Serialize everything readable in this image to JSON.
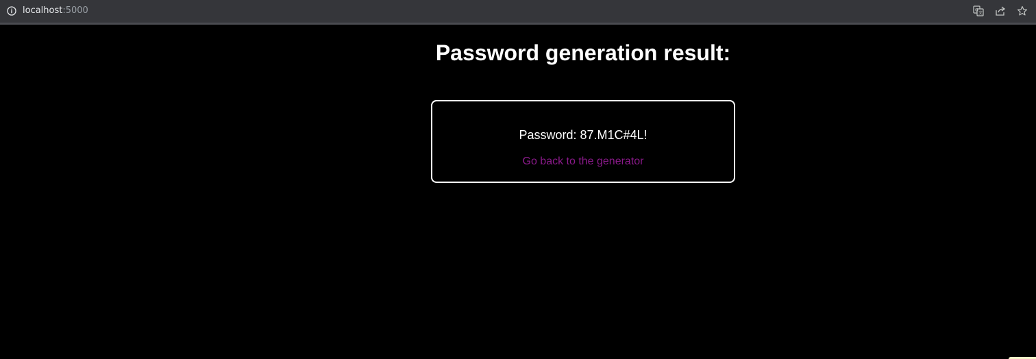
{
  "browser": {
    "url_host": "localhost",
    "url_port": ":5000",
    "icons": [
      "info-icon",
      "translate-icon",
      "share-icon",
      "star-icon"
    ]
  },
  "page": {
    "title": "Password generation result:",
    "password_label": "Password:",
    "password_value": "87.M1C#4L!",
    "back_link": "Go back to the generator"
  },
  "colors": {
    "background": "#000000",
    "text": "#ffffff",
    "link": "#8b1a8b",
    "card_border": "#ffffff"
  }
}
